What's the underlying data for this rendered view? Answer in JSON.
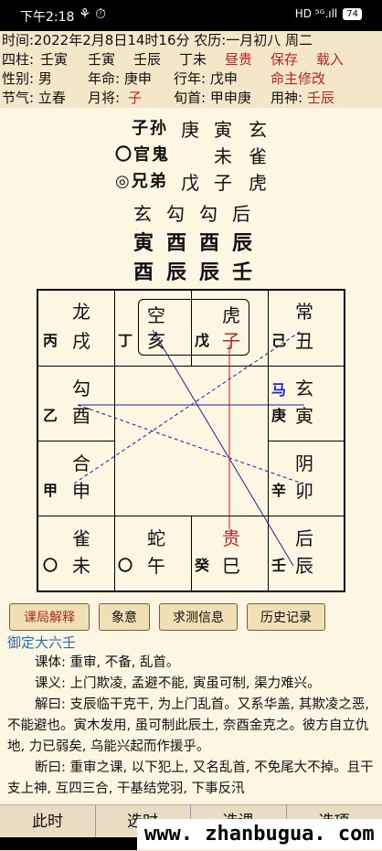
{
  "status_bar": {
    "time": "下午2:18",
    "icons": "⚘ ⏱",
    "right": "HD ⁵ᴳ.ıll",
    "battery": "74"
  },
  "info": {
    "row1": "时间:2022年2月8日14时16分 农历:一月初八 周二",
    "row2": {
      "label": "四柱:",
      "pillars": [
        "壬寅",
        "壬寅",
        "壬辰",
        "丁未"
      ],
      "actions": [
        "昼贵",
        "保存",
        "载入"
      ]
    },
    "row3": {
      "gender": "性别: 男",
      "mingming": "年命: 庚申",
      "xingnian": "行年: 戊申",
      "modify": "命主修改"
    },
    "row4": {
      "jieqi": "节气: 立春",
      "yuejiang_label": "月将:",
      "yuejiang": "子",
      "xunshou": "旬首: 甲申庚",
      "yongshen_label": "用神:",
      "yongshen": "壬辰"
    }
  },
  "san_chuan": [
    {
      "relation": "子孙",
      "gan": "庚",
      "zhi": "寅",
      "god": "玄"
    },
    {
      "relation": "〇官鬼",
      "gan": "",
      "zhi": "未",
      "god": "雀"
    },
    {
      "relation": "◎兄弟",
      "gan": "戊",
      "zhi": "子",
      "god": "虎"
    }
  ],
  "si_ke": {
    "row1": [
      "玄",
      "勾",
      "勾",
      "后"
    ],
    "row2": [
      "寅",
      "酉",
      "酉",
      "辰"
    ],
    "row3": [
      "酉",
      "辰",
      "辰",
      "壬"
    ]
  },
  "board": {
    "top": [
      {
        "god": "龙",
        "stem": "丙",
        "zhi": "戌"
      },
      {
        "god": "空",
        "stem": "丁",
        "zhi": "亥"
      },
      {
        "god": "虎",
        "stem": "戊",
        "zhi": "子"
      },
      {
        "god": "常",
        "stem": "己",
        "zhi": "丑"
      }
    ],
    "left": [
      {
        "god": "勾",
        "stem": "乙",
        "zhi": "酉"
      },
      {
        "god": "合",
        "stem": "甲",
        "zhi": "申"
      }
    ],
    "right": [
      {
        "god": "玄",
        "stem": "庚",
        "zhi": "寅",
        "mark": "马"
      },
      {
        "god": "阴",
        "stem": "辛",
        "zhi": "卯"
      }
    ],
    "bottom": [
      {
        "god": "雀",
        "stem": "〇",
        "zhi": "未"
      },
      {
        "god": "蛇",
        "stem": "〇",
        "zhi": "午"
      },
      {
        "god": "贵",
        "stem": "癸",
        "zhi": "巳"
      },
      {
        "god": "后",
        "stem": "壬",
        "zhi": "辰"
      }
    ]
  },
  "buttons": [
    "课局解释",
    "象意",
    "求测信息",
    "历史记录"
  ],
  "section_title": "御定大六壬",
  "paragraphs": [
    "课体: 重审, 不备, 乱首。",
    "课义: 上门欺凌, 孟避不能, 寅虽可制, 渠力难兴。",
    "解曰: 支辰临干克干, 为上门乱首。又系华盖, 其欺凌之恶, 不能避也。寅木发用, 虽可制此辰土, 奈酉金克之。彼方自立仇地, 力已弱矣, 乌能兴起而作援乎。",
    "断曰: 重审之课, 以下犯上, 又名乱首, 不免尾大不掉。且干支上神, 互四三合, 干基结党羽, 下事反汛"
  ],
  "bottom_nav": [
    "此时",
    "选时",
    "选课",
    "选项"
  ],
  "watermark": "www. zhanbugua. com",
  "colors": {
    "accent_red": "#b0282b",
    "info_bg": "#f4e6c8",
    "page_bg": "#fdf6e3"
  }
}
